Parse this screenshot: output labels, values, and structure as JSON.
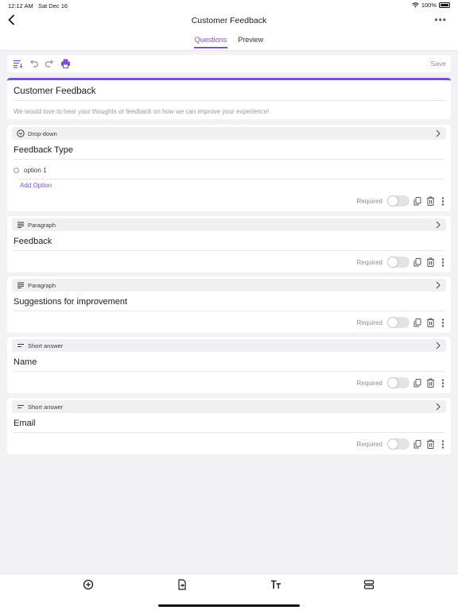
{
  "status_bar": {
    "time": "12:12 AM",
    "date": "Sat Dec 16",
    "battery": "100%"
  },
  "nav": {
    "title": "Customer Feedback",
    "more_icon": "ellipsis-icon",
    "back_icon": "chevron-left-icon"
  },
  "tabs": [
    {
      "label": "Questions",
      "active": true
    },
    {
      "label": "Preview",
      "active": false
    }
  ],
  "toolbar": {
    "save_label": "Save"
  },
  "form": {
    "title": "Customer Feedback",
    "description": "We would love to hear your thoughts or feedback on how we can improve your experience!"
  },
  "questions": [
    {
      "type": "Drop-down",
      "title": "Feedback Type",
      "options": [
        "option 1"
      ],
      "add_option_label": "Add Option",
      "required_label": "Required",
      "required": false
    },
    {
      "type": "Paragraph",
      "title": "Feedback",
      "required_label": "Required",
      "required": false
    },
    {
      "type": "Paragraph",
      "title": "Suggestions for improvement",
      "required_label": "Required",
      "required": false
    },
    {
      "type": "Short answer",
      "title": "Name",
      "required_label": "Required",
      "required": false
    },
    {
      "type": "Short answer",
      "title": "Email",
      "required_label": "Required",
      "required": false
    }
  ],
  "colors": {
    "accent": "#7d4fd6",
    "background": "#f2f2f4"
  },
  "bottom_bar": [
    "add-circle-icon",
    "import-file-icon",
    "text-style-icon",
    "section-icon"
  ]
}
